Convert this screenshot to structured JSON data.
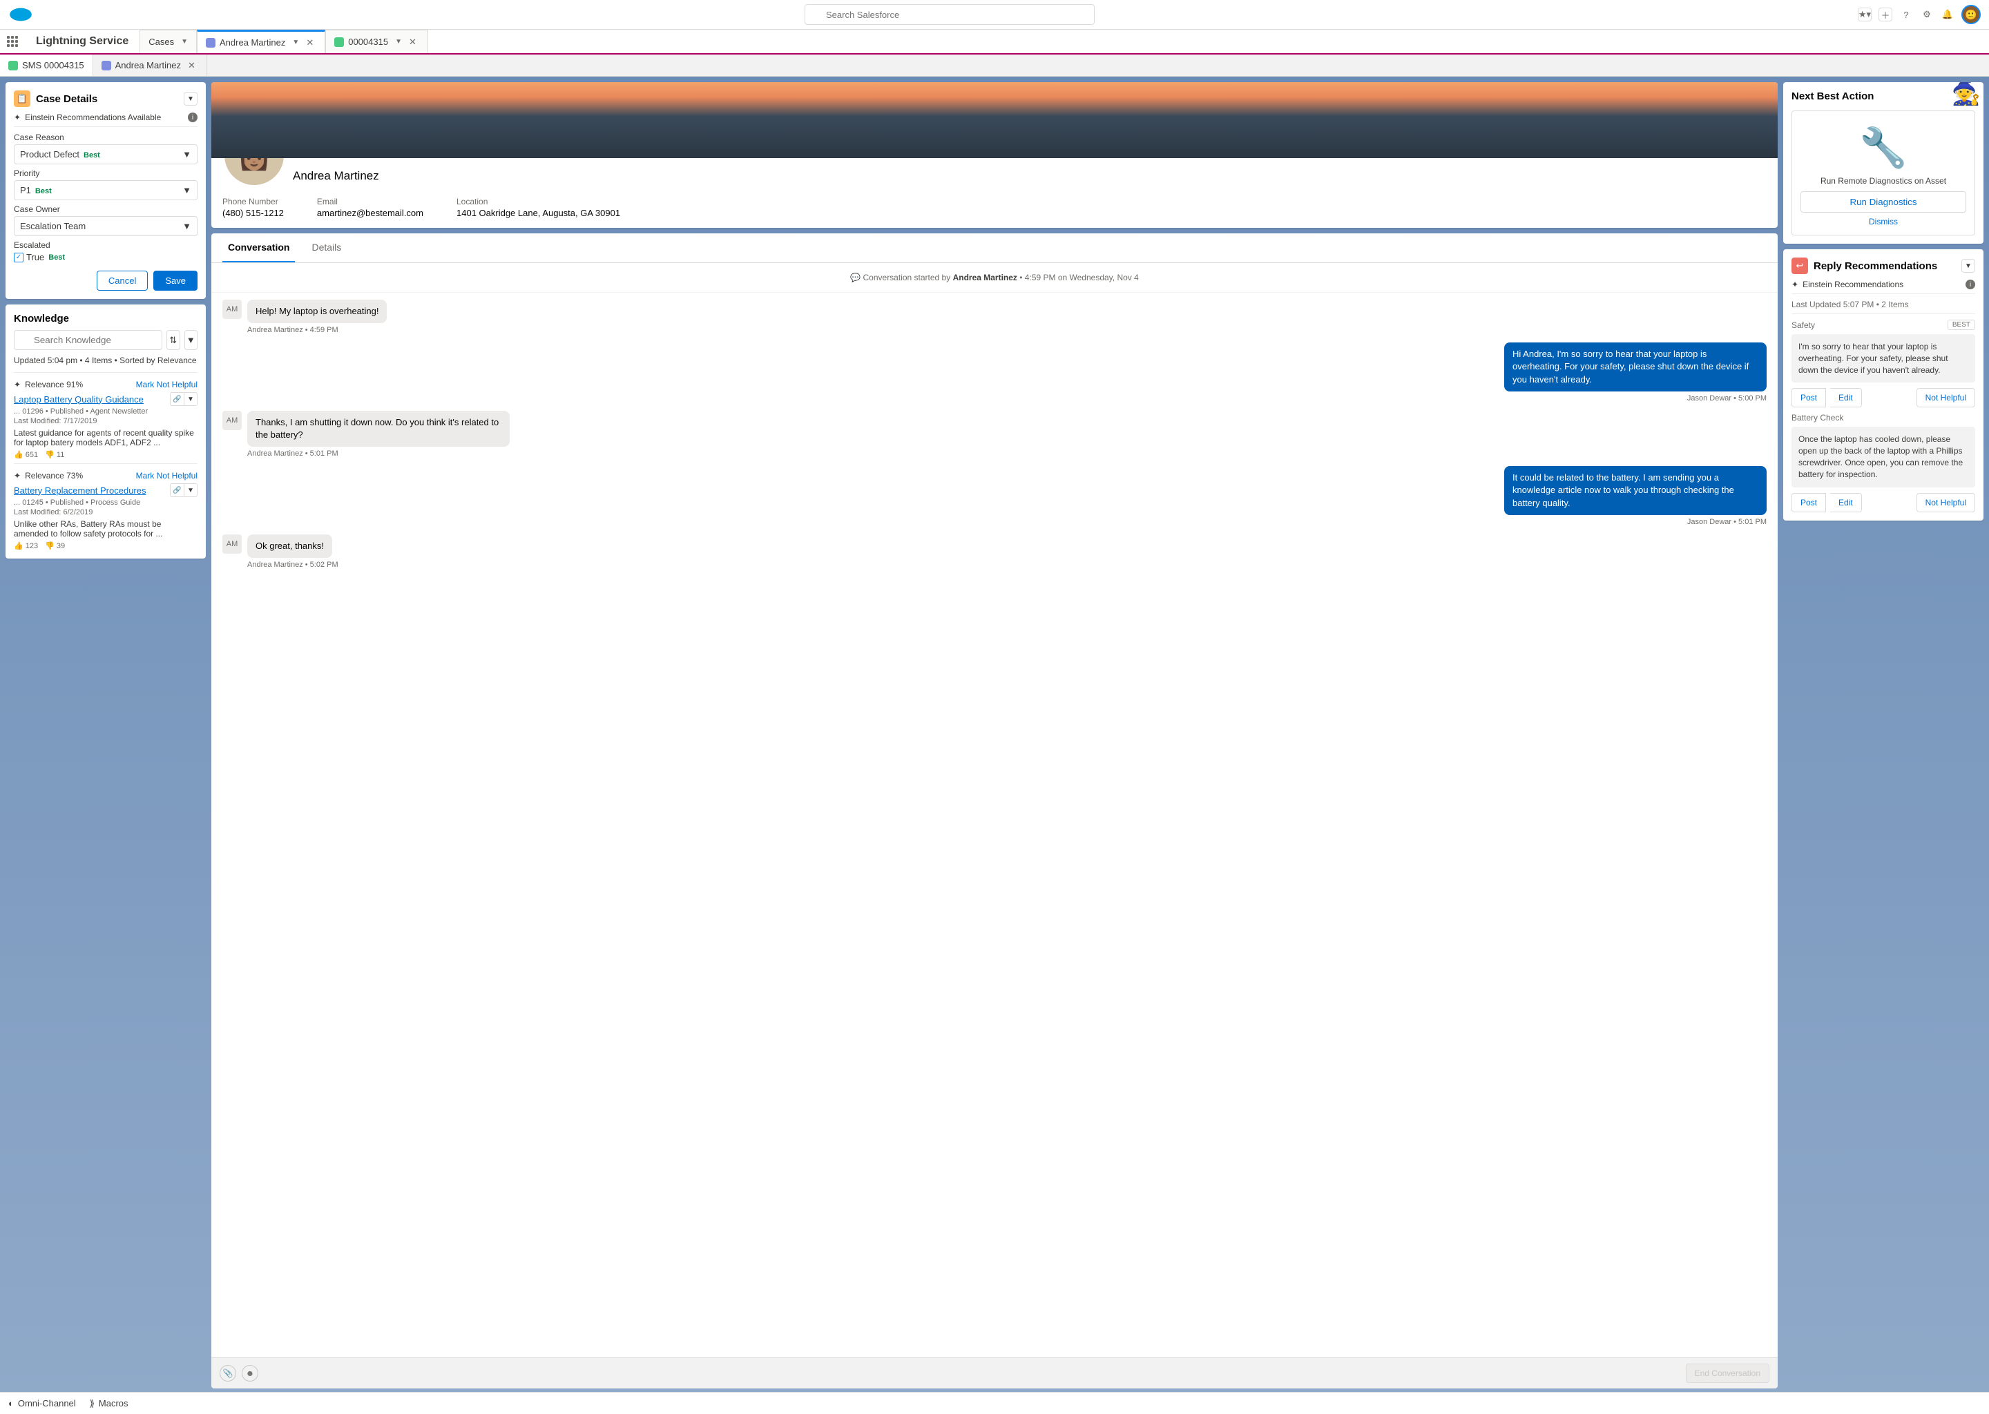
{
  "header": {
    "search_placeholder": "Search Salesforce"
  },
  "nav": {
    "app_name": "Lightning Service",
    "tabs": [
      {
        "label": "Cases"
      },
      {
        "label": "Andrea Martinez"
      },
      {
        "label": "00004315"
      }
    ]
  },
  "subtabs": [
    {
      "label": "SMS 00004315"
    },
    {
      "label": "Andrea Martinez"
    }
  ],
  "case_details": {
    "title": "Case Details",
    "einstein": "Einstein Recommendations Available",
    "reason_label": "Case Reason",
    "reason_value": "Product Defect",
    "reason_best": "Best",
    "priority_label": "Priority",
    "priority_value": "P1",
    "priority_best": "Best",
    "owner_label": "Case Owner",
    "owner_value": "Escalation Team",
    "escalated_label": "Escalated",
    "escalated_value": "True",
    "escalated_best": "Best",
    "cancel": "Cancel",
    "save": "Save"
  },
  "knowledge": {
    "title": "Knowledge",
    "search_placeholder": "Search Knowledge",
    "meta": "Updated 5:04 pm • 4 Items • Sorted by Relevance",
    "items": [
      {
        "relevance": "Relevance 91%",
        "not_helpful": "Mark Not Helpful",
        "title": "Laptop Battery Quality Guidance",
        "sub": "... 01296  •  Published  •  Agent Newsletter",
        "modified": "Last Modified: 7/17/2019",
        "desc": "Latest guidance for agents of recent quality spike for laptop batery models ADF1, ADF2 ...",
        "up": "651",
        "down": "11"
      },
      {
        "relevance": "Relevance 73%",
        "not_helpful": "Mark Not Helpful",
        "title": "Battery Replacement Procedures",
        "sub": "... 01245  •  Published  •  Process Guide",
        "modified": "Last Modified: 6/2/2019",
        "desc": "Unlike other RAs, Battery RAs moust be amended to follow safety protocols for ...",
        "up": "123",
        "down": "39"
      }
    ]
  },
  "profile": {
    "name": "Andrea Martinez",
    "phone_label": "Phone Number",
    "phone": "(480) 515-1212",
    "email_label": "Email",
    "email": "amartinez@bestemail.com",
    "location_label": "Location",
    "location": "1401 Oakridge Lane, Augusta, GA 30901"
  },
  "conversation": {
    "tab_conv": "Conversation",
    "tab_details": "Details",
    "started_prefix": "Conversation started by ",
    "started_name": "Andrea Martinez",
    "started_time": " • 4:59 PM on Wednesday, Nov 4",
    "end_btn": "End Conversation",
    "messages": [
      {
        "dir": "in",
        "av": "AM",
        "text": "Help!  My laptop is overheating!",
        "meta": "Andrea Martinez • 4:59 PM"
      },
      {
        "dir": "out",
        "text": "Hi Andrea, I'm so sorry to hear that your laptop is overheating.  For your safety, please shut down the device if you haven't already.",
        "meta": "Jason Dewar • 5:00 PM"
      },
      {
        "dir": "in",
        "av": "AM",
        "text": "Thanks, I am shutting it down now.  Do you think it's related to the battery?",
        "meta": "Andrea Martinez • 5:01 PM"
      },
      {
        "dir": "out",
        "text": "It could be related to the battery.  I am sending you a knowledge article now to walk you through checking the battery quality.",
        "meta": "Jason Dewar • 5:01 PM"
      },
      {
        "dir": "in",
        "av": "AM",
        "text": "Ok great, thanks!",
        "meta": "Andrea Martinez • 5:02 PM"
      }
    ]
  },
  "nba": {
    "title": "Next Best Action",
    "desc": "Run Remote Diagnostics on Asset",
    "btn": "Run Diagnostics",
    "dismiss": "Dismiss"
  },
  "reply": {
    "title": "Reply Recommendations",
    "einstein": "Einstein Recommendations",
    "meta": "Last Updated 5:07 PM • 2 Items",
    "post": "Post",
    "edit": "Edit",
    "not_helpful": "Not Helpful",
    "sections": [
      {
        "hdr": "Safety",
        "best": "BEST",
        "body": "I'm so sorry to hear that your laptop is overheating. For your safety, please shut down the device if you haven't already."
      },
      {
        "hdr": "Battery Check",
        "best": "",
        "body": "Once the laptop has cooled down, please open up the back of the laptop with a Phillips screwdriver.  Once open, you can remove the battery for inspection."
      }
    ]
  },
  "footer": {
    "omni": "Omni-Channel",
    "macros": "Macros"
  }
}
